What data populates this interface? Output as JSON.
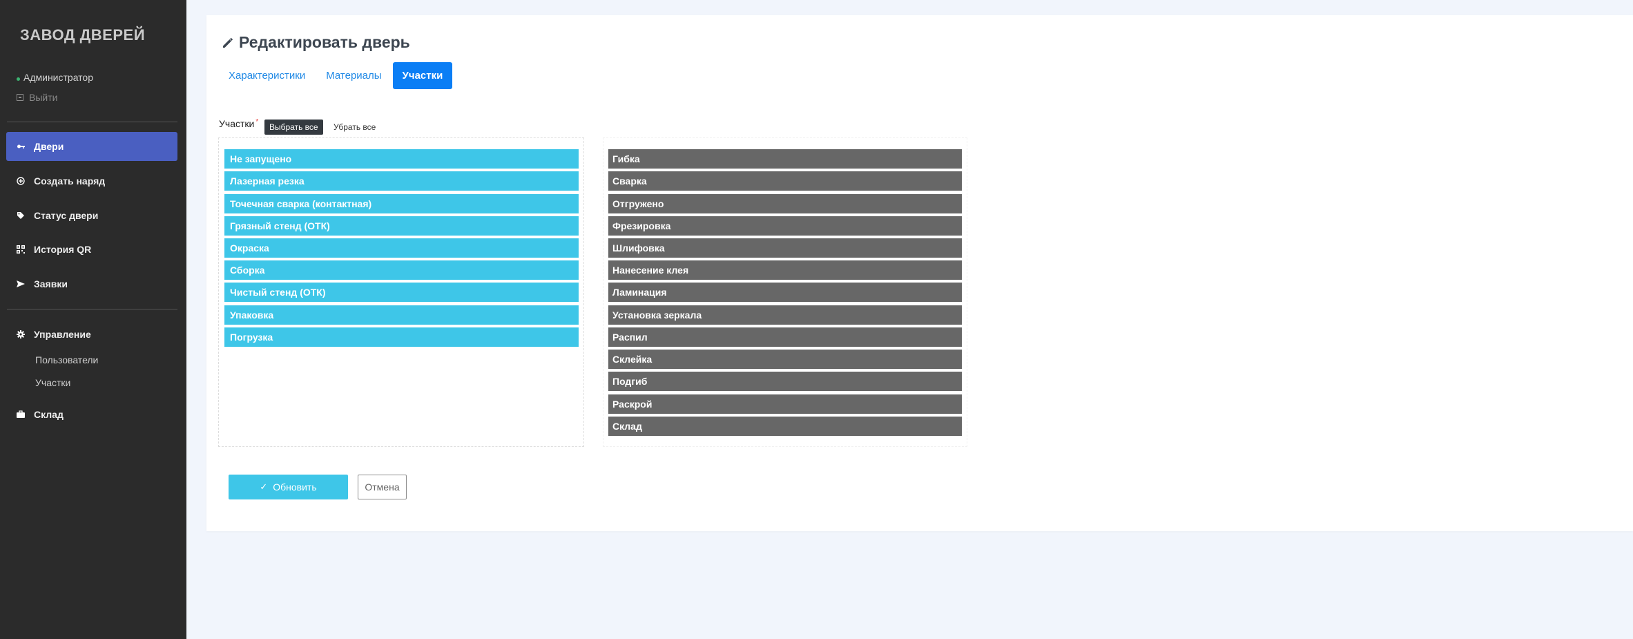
{
  "sidebar": {
    "brand": "ЗАВОД ДВЕРЕЙ",
    "user": "Администратор",
    "logout": "Выйти",
    "nav": [
      {
        "label": "Двери",
        "icon": "key-icon"
      },
      {
        "label": "Создать наряд",
        "icon": "plus-circle-icon"
      },
      {
        "label": "Статус двери",
        "icon": "tag-icon"
      },
      {
        "label": "История QR",
        "icon": "qrcode-icon"
      },
      {
        "label": "Заявки",
        "icon": "paper-plane-icon"
      }
    ],
    "management": {
      "label": "Управление",
      "icon": "gear-icon",
      "items": [
        "Пользователи",
        "Участки"
      ]
    },
    "warehouse": {
      "label": "Склад",
      "icon": "briefcase-icon"
    }
  },
  "page": {
    "title": "Редактировать дверь",
    "title_icon": "pencil-icon",
    "tabs": [
      "Характеристики",
      "Материалы",
      "Участки"
    ],
    "active_tab": "Участки"
  },
  "form": {
    "field_label": "Участки",
    "required_mark": "*",
    "select_all": "Выбрать все",
    "clear_all": "Убрать все",
    "selected": [
      "Не запущено",
      "Лазерная резка",
      "Точечная сварка (контактная)",
      "Грязный стенд (ОТК)",
      "Окраска",
      "Сборка",
      "Чистый стенд (ОТК)",
      "Упаковка",
      "Погрузка"
    ],
    "available": [
      "Гибка",
      "Сварка",
      "Отгружено",
      "Фрезировка",
      "Шлифовка",
      "Нанесение клея",
      "Ламинация",
      "Установка зеркала",
      "Распил",
      "Склейка",
      "Подгиб",
      "Раскрой",
      "Склад"
    ],
    "update_button": "Обновить",
    "cancel_button": "Отмена"
  },
  "colors": {
    "sidebar_bg": "#2b2b2b",
    "active_nav": "#4a5fc1",
    "active_tab": "#0b7ef5",
    "selected_chip": "#3ec6e8",
    "available_chip": "#676767"
  }
}
